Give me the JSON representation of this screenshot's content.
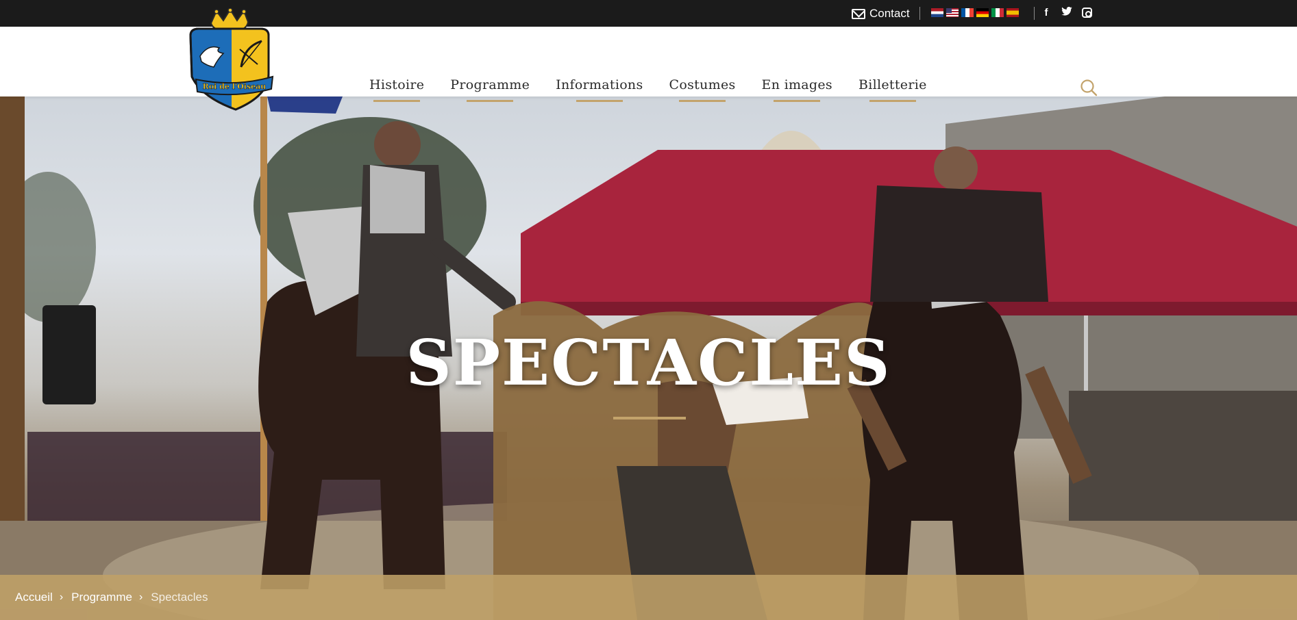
{
  "topbar": {
    "contact_label": "Contact",
    "flags": [
      "nl",
      "us",
      "fr",
      "de",
      "it",
      "es"
    ],
    "social": [
      {
        "name": "facebook-icon",
        "glyph": "f"
      },
      {
        "name": "twitter-icon",
        "glyph": "🐦"
      },
      {
        "name": "instagram-icon",
        "glyph": ""
      }
    ]
  },
  "logo": {
    "text": "Roi de l'Oiseau"
  },
  "nav": {
    "items": [
      "Histoire",
      "Programme",
      "Informations",
      "Costumes",
      "En images",
      "Billetterie"
    ]
  },
  "hero": {
    "title": "SPECTACLES"
  },
  "breadcrumb": {
    "home": "Accueil",
    "parent": "Programme",
    "current": "Spectacles"
  },
  "colors": {
    "accent": "#c3a36b",
    "topbar": "#1b1b1b",
    "tent": "#a8243d"
  }
}
